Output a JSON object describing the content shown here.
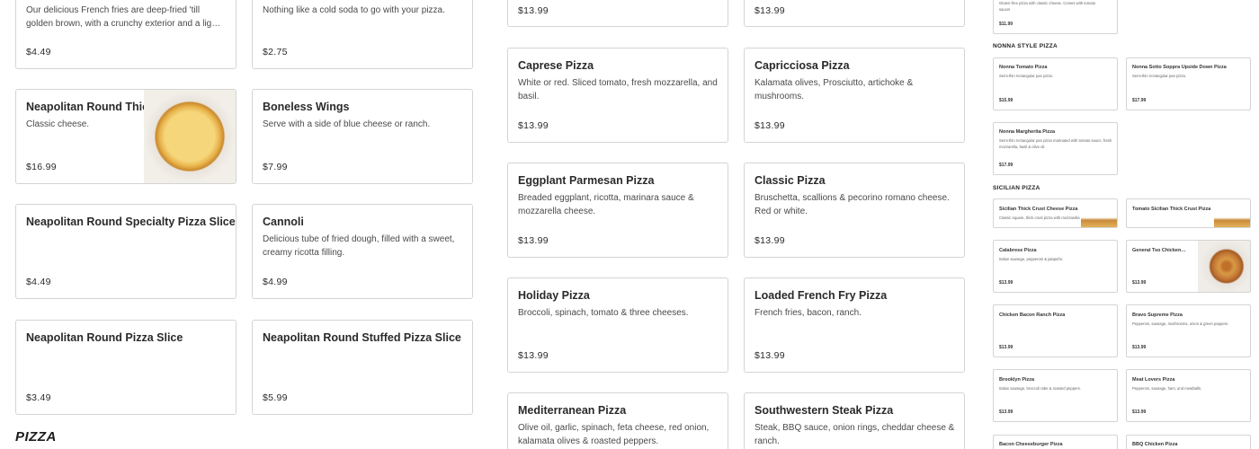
{
  "col1": {
    "fries": {
      "desc": "Our delicious French fries are deep-fried 'till golden brown, with a crunchy exterior and a lig…",
      "price": "$4.49"
    },
    "thick": {
      "name": "Neapolitan Round Thick",
      "desc": "Classic cheese.",
      "price": "$16.99"
    },
    "specialty": {
      "name": "Neapolitan Round Specialty Pizza Slice",
      "price": "$4.49"
    },
    "slice": {
      "name": "Neapolitan Round Pizza Slice",
      "price": "$3.49"
    }
  },
  "col2": {
    "soda": {
      "desc": "Nothing like a cold soda to go with your pizza.",
      "price": "$2.75"
    },
    "wings": {
      "name": "Boneless Wings",
      "desc": "Serve with a side of blue cheese or ranch.",
      "price": "$7.99"
    },
    "cannoli": {
      "name": "Cannoli",
      "desc": "Delicious tube of fried dough, filled with a sweet, creamy ricotta filling.",
      "price": "$4.99"
    },
    "stuffed": {
      "name": "Neapolitan Round Stuffed Pizza Slice",
      "price": "$5.99"
    }
  },
  "col3": {
    "top": {
      "price": "$13.99"
    },
    "caprese": {
      "name": "Caprese Pizza",
      "desc": "White or red. Sliced tomato, fresh mozzarella, and basil.",
      "price": "$13.99"
    },
    "eggplant": {
      "name": "Eggplant Parmesan Pizza",
      "desc": "Breaded eggplant, ricotta, marinara sauce & mozzarella cheese.",
      "price": "$13.99"
    },
    "holiday": {
      "name": "Holiday Pizza",
      "desc": "Broccoli, spinach, tomato & three cheeses.",
      "price": "$13.99"
    },
    "mediterranean": {
      "name": "Mediterranean Pizza",
      "desc": "Olive oil, garlic, spinach, feta cheese, red onion, kalamata olives & roasted peppers."
    }
  },
  "col4": {
    "top": {
      "price": "$13.99"
    },
    "capricciosa": {
      "name": "Capricciosa Pizza",
      "desc": "Kalamata olives, Prosciutto, artichoke & mushrooms.",
      "price": "$13.99"
    },
    "classic": {
      "name": "Classic Pizza",
      "desc": "Bruschetta, scallions & pecorino romano cheese. Red or white.",
      "price": "$13.99"
    },
    "loaded": {
      "name": "Loaded French Fry Pizza",
      "desc": "French fries, bacon, ranch.",
      "price": "$13.99"
    },
    "steak": {
      "name": "Southwestern Steak Pizza",
      "desc": "Steak, BBQ sauce, onion rings, cheddar cheese & ranch."
    }
  },
  "section_pizza": "PIZZA",
  "right": {
    "top_card": {
      "desc": "Gluten-free pizza with classic cheese. Comes with tomato sauce!",
      "price": "$11.99"
    },
    "nonna_header": "NONNA STYLE PIZZA",
    "nonna_tomato": {
      "name": "Nonna Tomato Pizza",
      "desc": "Semi-thin rectangular pan pizza.",
      "price": "$15.99"
    },
    "nonna_sotto": {
      "name": "Nonna Sotto Soppra Upside Down Pizza",
      "desc": "Semi-thin rectangular pan pizza.",
      "price": "$17.99"
    },
    "nonna_margherita": {
      "name": "Nonna Margherita Pizza",
      "desc": "Semi-thin rectangular pan pizza marinated with tomato sauce, fresh mozzarella, basil & olive oil.",
      "price": "$17.99"
    },
    "sicilian_header": "SICILIAN PIZZA",
    "sicilian_cheese": {
      "name": "Sicilian Thick Crust Cheese Pizza",
      "desc": "Classic square, thick crust pizza with mozzarella"
    },
    "tomato_sicilian": {
      "name": "Tomato Sicilian Thick Crust Pizza"
    },
    "calabrese": {
      "name": "Calabrese Pizza",
      "desc": "Italian sausage, pepperoni & jalapeño.",
      "price": "$13.99"
    },
    "general_tso": {
      "name": "General Tso Chicken…",
      "price": "$13.99"
    },
    "chicken_bacon": {
      "name": "Chicken Bacon Ranch Pizza",
      "price": "$13.99"
    },
    "bravo": {
      "name": "Bravo Supreme Pizza",
      "desc": "Pepperoni, sausage, mushrooms, onion & green peppers.",
      "price": "$13.99"
    },
    "brooklyn": {
      "name": "Brooklyn Pizza",
      "desc": "Italian sausage, broccoli rabe & roasted peppers.",
      "price": "$13.99"
    },
    "meat_lovers": {
      "name": "Meat Lovers Pizza",
      "desc": "Pepperoni, sausage, ham, and meatballs.",
      "price": "$13.99"
    },
    "bacon_cheese": {
      "name": "Bacon Cheeseburger Pizza"
    },
    "bbq_chicken": {
      "name": "BBQ Chicken Pizza"
    }
  }
}
